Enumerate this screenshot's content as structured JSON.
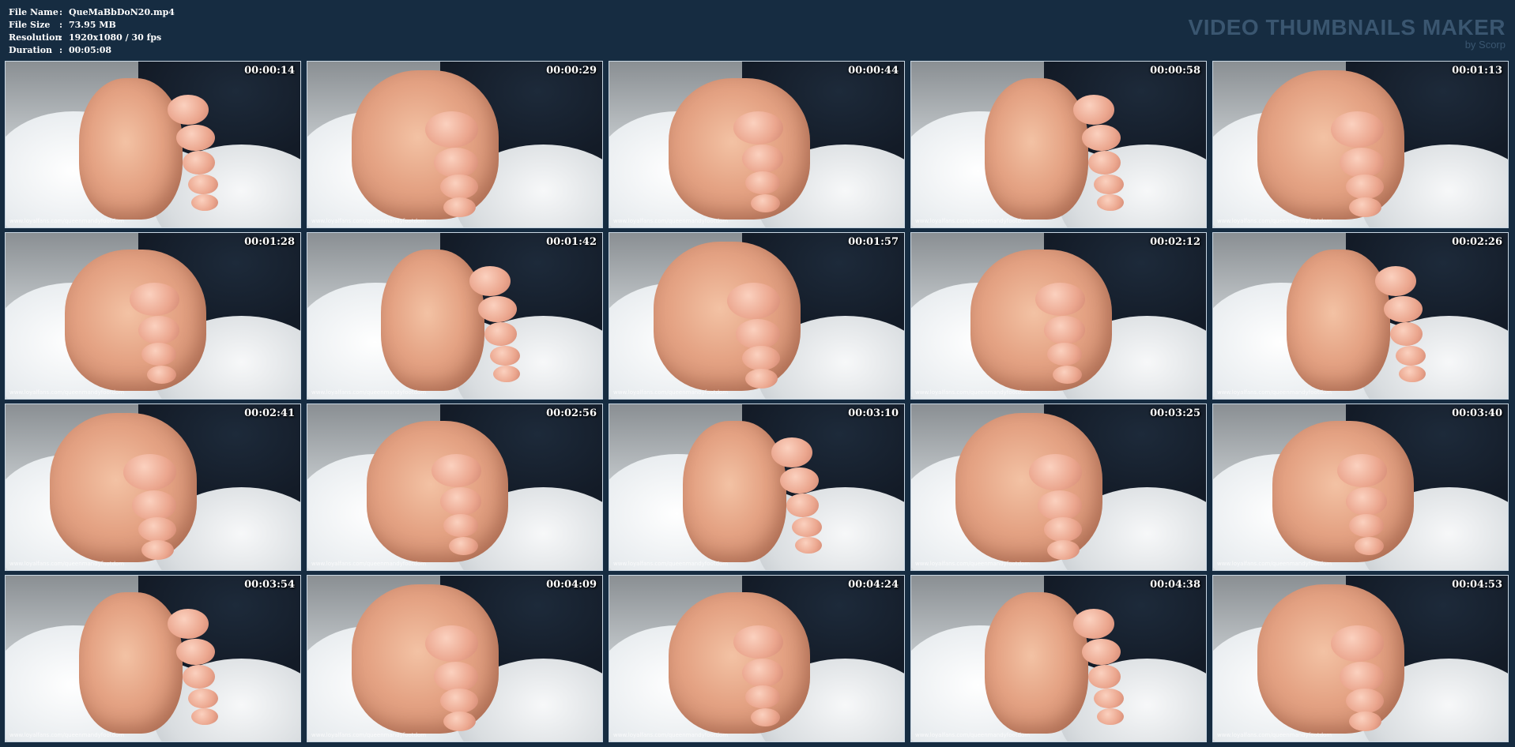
{
  "file_info": {
    "name_label": "File Name",
    "name_value": "QueMaBbDoN20.mp4",
    "size_label": "File Size",
    "size_value": "73.95 MB",
    "resolution_label": "Resolution",
    "resolution_value": "1920x1080 / 30 fps",
    "duration_label": "Duration",
    "duration_value": "00:05:08",
    "separator": ":"
  },
  "brand": {
    "title": "VIDEO THUMBNAILS MAKER",
    "subtitle": "by Scorp"
  },
  "watermark": "www.loyalfans.com/queenmandyfootdom",
  "thumbnails": [
    {
      "time": "00:00:14"
    },
    {
      "time": "00:00:29"
    },
    {
      "time": "00:00:44"
    },
    {
      "time": "00:00:58"
    },
    {
      "time": "00:01:13"
    },
    {
      "time": "00:01:28"
    },
    {
      "time": "00:01:42"
    },
    {
      "time": "00:01:57"
    },
    {
      "time": "00:02:12"
    },
    {
      "time": "00:02:26"
    },
    {
      "time": "00:02:41"
    },
    {
      "time": "00:02:56"
    },
    {
      "time": "00:03:10"
    },
    {
      "time": "00:03:25"
    },
    {
      "time": "00:03:40"
    },
    {
      "time": "00:03:54"
    },
    {
      "time": "00:04:09"
    },
    {
      "time": "00:04:24"
    },
    {
      "time": "00:04:38"
    },
    {
      "time": "00:04:53"
    }
  ]
}
